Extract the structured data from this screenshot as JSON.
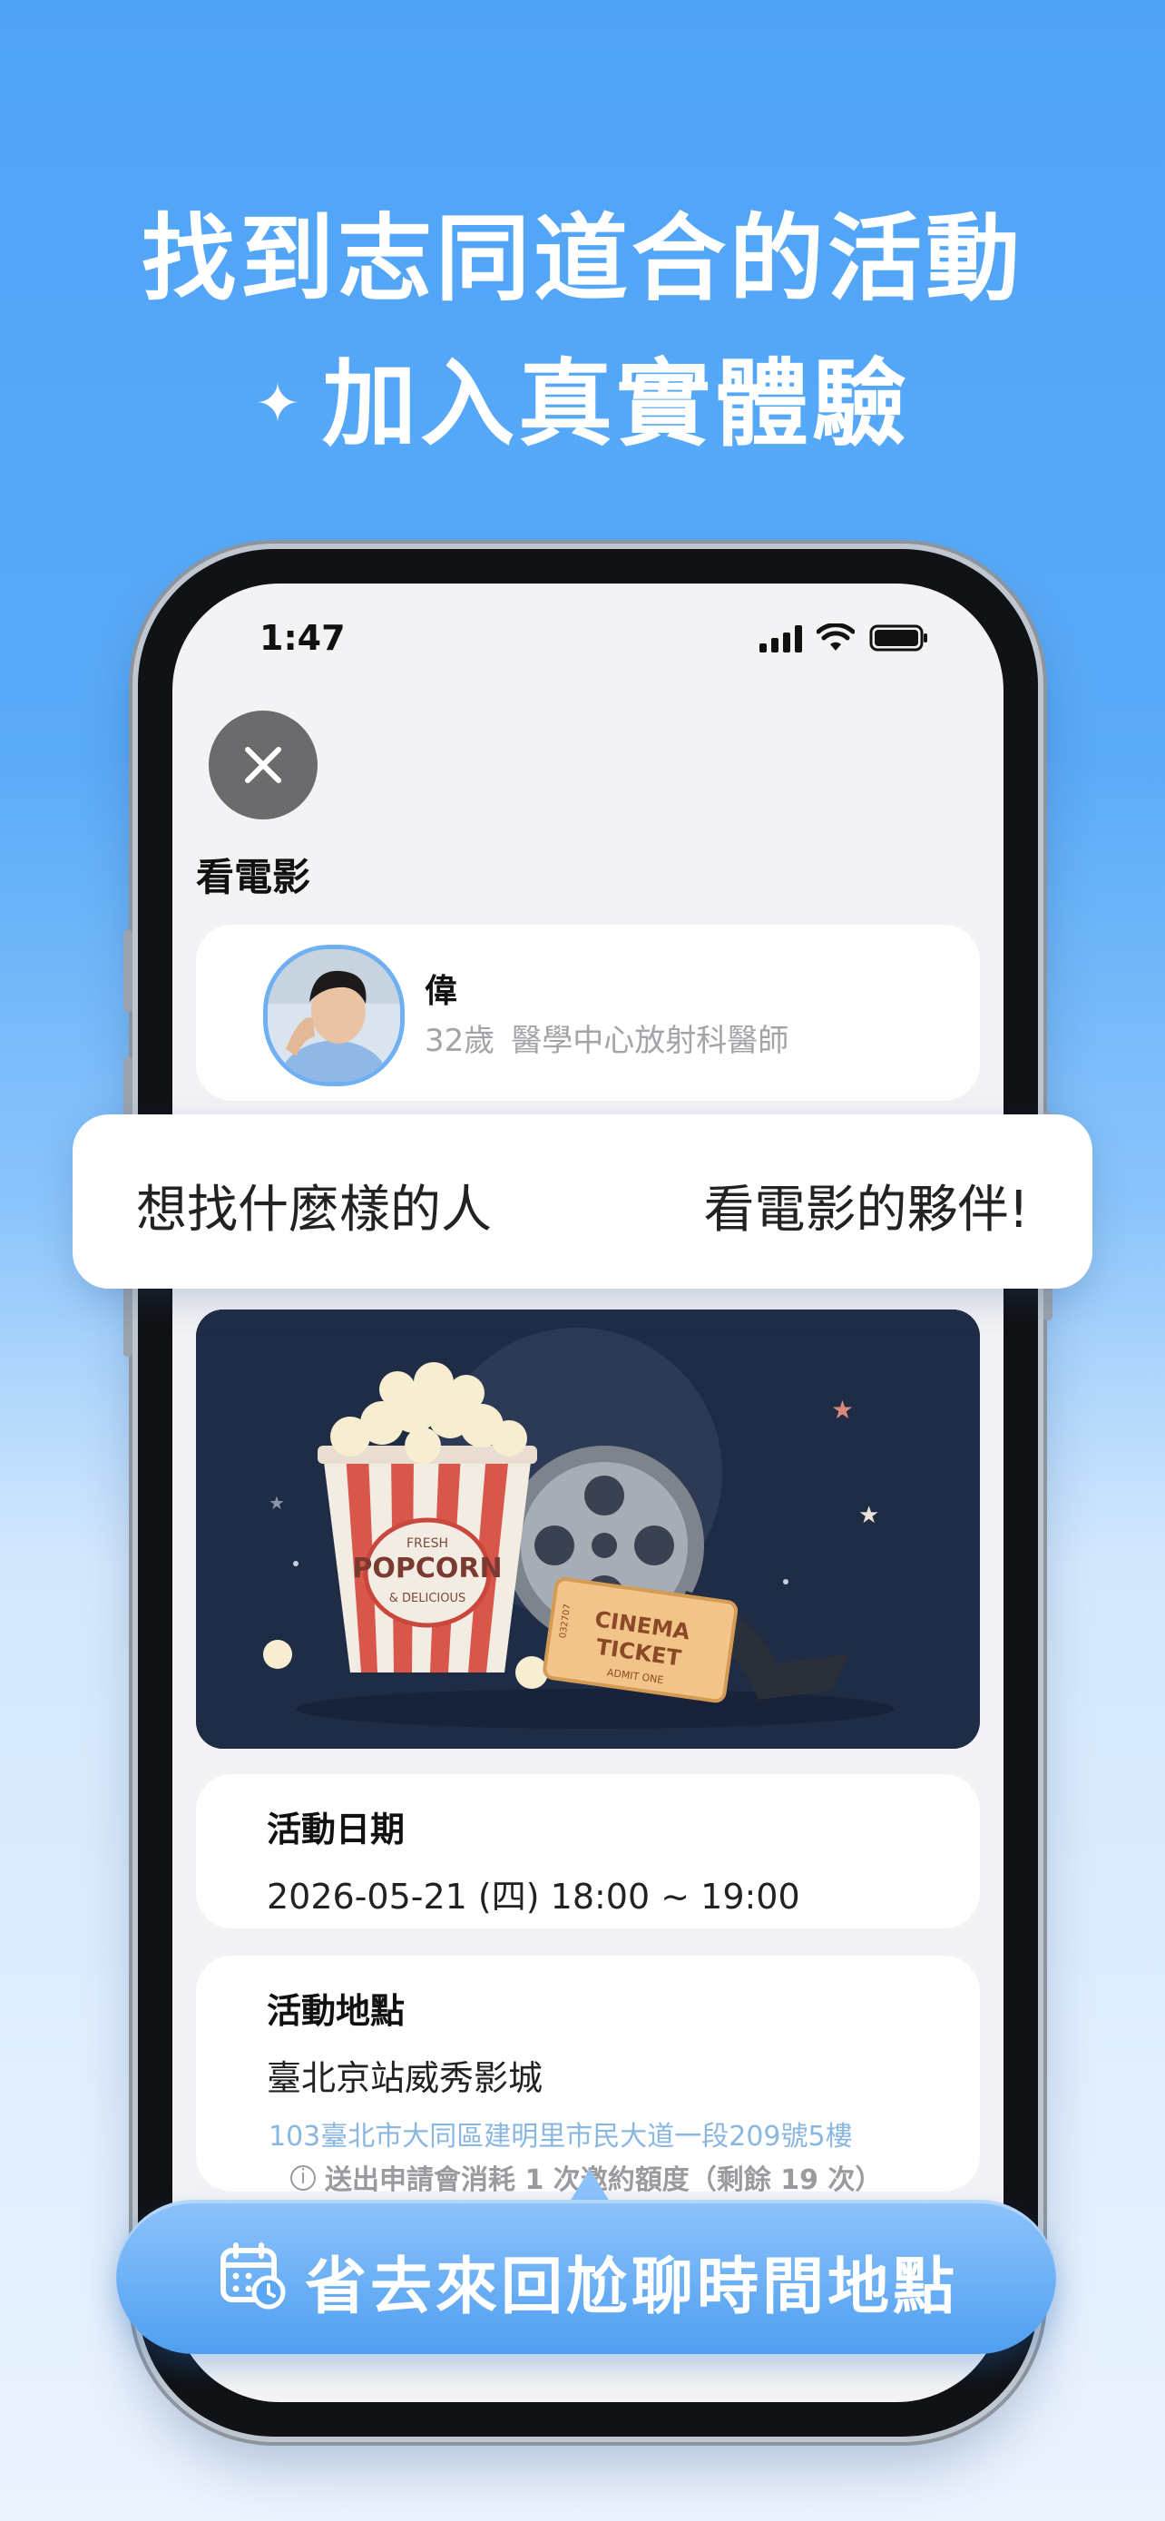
{
  "headline": {
    "line1": "找到志同道合的活動",
    "line2_sparkle": "✦",
    "line2": "加入真實體驗"
  },
  "status_bar": {
    "time": "1:47"
  },
  "page": {
    "title": "看電影",
    "profile": {
      "name": "偉",
      "age": "32歲",
      "occupation": "醫學中心放射科醫師"
    },
    "looking_for": {
      "label": "想找什麼樣的人",
      "value": "看電影的夥伴!"
    },
    "image_texts": {
      "popcorn_fresh": "FRESH",
      "popcorn": "POPCORN",
      "popcorn_sub": "& DELICIOUS",
      "ticket1": "CINEMA",
      "ticket2": "TICKET",
      "ticket_sub": "ADMIT ONE",
      "ticket_no": "032707"
    },
    "date_card": {
      "label": "活動日期",
      "value": "2026-05-21 (四) 18:00 ~ 19:00"
    },
    "location_card": {
      "label": "活動地點",
      "venue": "臺北京站威秀影城",
      "address": "103臺北市大同區建明里市民大道一段209號5樓"
    },
    "quota_note": "送出申請會消耗 1 次邀約額度（剩餘 19 次）"
  },
  "callout": {
    "text": "省去來回尬聊時間地點"
  },
  "colors": {
    "accent": "#4fa3f7",
    "pill": "#5aa8f5",
    "address": "#8ab6e2"
  }
}
